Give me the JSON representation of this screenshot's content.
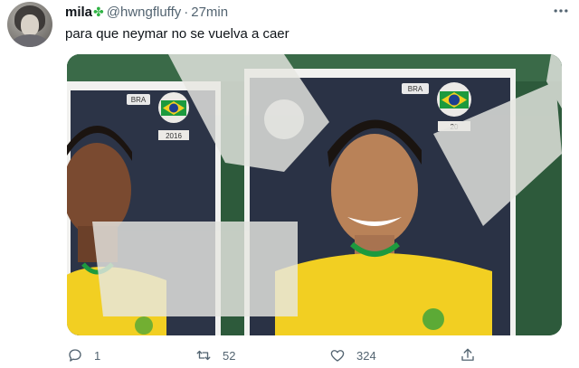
{
  "tweet": {
    "author": {
      "display_name": "mila",
      "name_emoji": "✤",
      "handle": "@hwngfluffy",
      "separator": "·",
      "time": "27min",
      "avatar_icon": "avatar"
    },
    "more_icon": "more-icon",
    "text": "para que neymar no se vuelva a caer",
    "media": {
      "sticker_left": {
        "team": "BRA",
        "year": "2016"
      },
      "sticker_right": {
        "team": "BRA",
        "year": "20"
      }
    },
    "actions": {
      "reply": {
        "icon": "reply-icon",
        "count": "1"
      },
      "retweet": {
        "icon": "retweet-icon",
        "count": "52"
      },
      "like": {
        "icon": "heart-icon",
        "count": "324"
      },
      "share": {
        "icon": "share-icon"
      }
    }
  },
  "colors": {
    "text_primary": "#0f1419",
    "text_secondary": "#536471",
    "clover": "#2fb344",
    "brazil_yellow": "#f2cf22",
    "brazil_green": "#1d9a3e"
  }
}
